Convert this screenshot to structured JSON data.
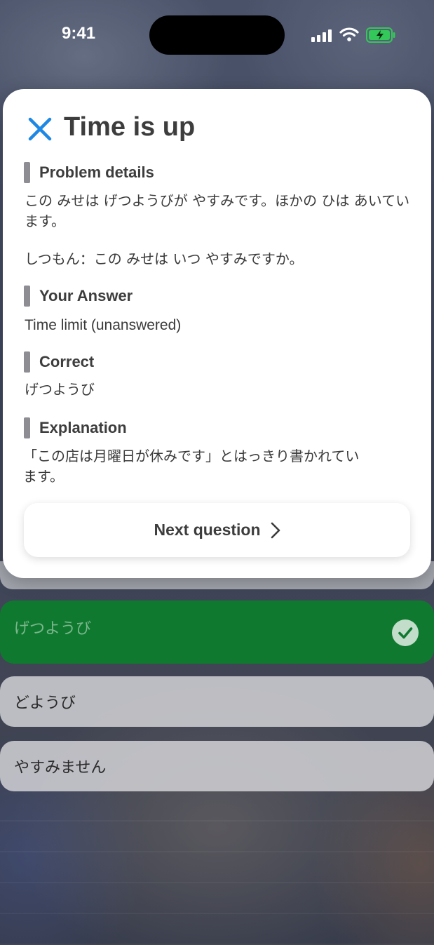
{
  "status_bar": {
    "time": "9:41"
  },
  "modal": {
    "title": "Time is up",
    "sections": {
      "problem": {
        "title": "Problem details",
        "line1": "この みせは げつようびが やすみです。ほかの ひは あいています。",
        "line2": "しつもん：この みせは いつ やすみですか。"
      },
      "your_answer": {
        "title": "Your Answer",
        "value": "Time limit (unanswered)"
      },
      "correct": {
        "title": "Correct",
        "value": "げつようび"
      },
      "explanation": {
        "title": "Explanation",
        "value": "「この店は月曜日が休みです」とはっきり書かれています。"
      }
    },
    "next_button": {
      "label": "Next question"
    }
  },
  "options": [
    {
      "label": "げつようび",
      "state": "correct"
    },
    {
      "label": "どようび",
      "state": "default"
    },
    {
      "label": "やすみません",
      "state": "default"
    }
  ],
  "colors": {
    "accent": "#1E88E5",
    "correct_green": "#0F7A2F",
    "section_bar": "#8D8D93",
    "battery_green": "#34C759"
  }
}
